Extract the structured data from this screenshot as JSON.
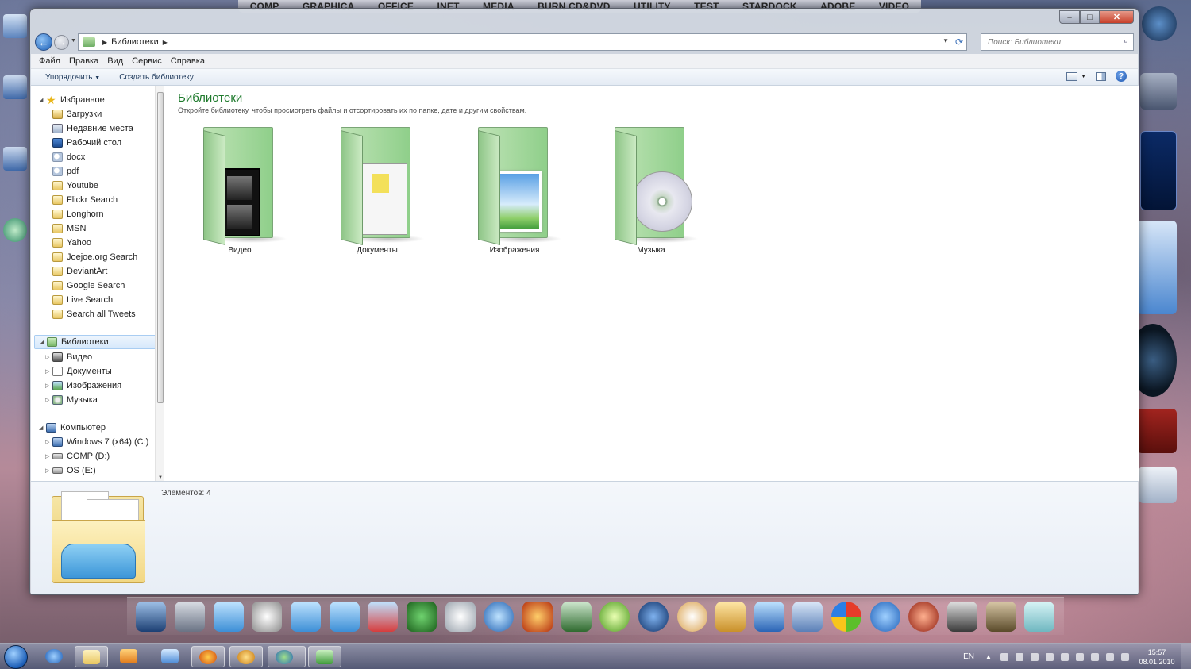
{
  "topbar": {
    "items": [
      "COMP",
      "GRAPHICA",
      "OFFICE",
      "INET",
      "MEDIA",
      "BURN CD&DVD",
      "UTILITY",
      "TEST",
      "STARDOCK",
      "ADOBE",
      "VIDEO"
    ]
  },
  "address": {
    "crumb": "Библиотеки",
    "search_placeholder": "Поиск: Библиотеки"
  },
  "menubar": {
    "items": [
      "Файл",
      "Правка",
      "Вид",
      "Сервис",
      "Справка"
    ]
  },
  "toolbar": {
    "organize": "Упорядочить",
    "new_library": "Создать библиотеку"
  },
  "nav": {
    "favorites_label": "Избранное",
    "favorites": [
      "Загрузки",
      "Недавние места",
      "Рабочий стол",
      "docx",
      "pdf",
      "Youtube",
      "Flickr Search",
      "Longhorn",
      "MSN",
      "Yahoo",
      "Joejoe.org Search",
      "DeviantArt",
      "Google Search",
      "Live Search",
      "Search all Tweets"
    ],
    "libraries_label": "Библиотеки",
    "libraries": [
      "Видео",
      "Документы",
      "Изображения",
      "Музыка"
    ],
    "computer_label": "Компьютер",
    "drives": [
      "Windows 7 (x64) (C:)",
      "COMP (D:)",
      "OS (E:)"
    ]
  },
  "content": {
    "title": "Библиотеки",
    "subtitle": "Откройте библиотеку, чтобы просмотреть файлы и отсортировать их по папке, дате и другим свойствам.",
    "libraries": [
      "Видео",
      "Документы",
      "Изображения",
      "Музыка"
    ]
  },
  "details": {
    "count": "Элементов: 4"
  },
  "tray": {
    "lang": "EN",
    "time": "15:57",
    "date": "08.01.2010"
  },
  "colors": {
    "library_title": "#1e7a2c",
    "selection": "#d6e8fb",
    "close_button": "#c8402a"
  }
}
